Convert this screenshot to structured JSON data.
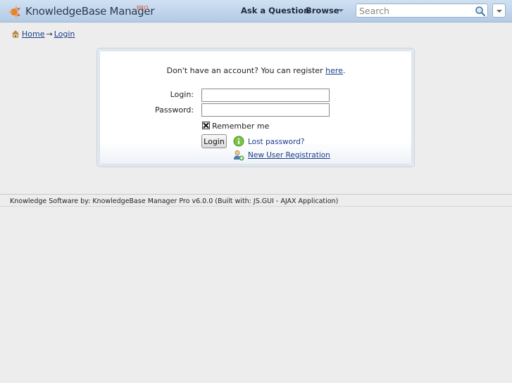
{
  "header": {
    "app_name": "KnowledgeBase Manager",
    "app_edition": "PRO",
    "nav": {
      "ask": "Ask a Question",
      "browse": "Browse"
    },
    "search": {
      "placeholder": "Search",
      "value": ""
    }
  },
  "breadcrumb": {
    "home": "Home",
    "separator": "→",
    "current": "Login"
  },
  "login": {
    "register_text": "Don't have an account? You can register ",
    "register_link": "here",
    "register_end": ".",
    "login_label": "Login:",
    "password_label": "Password:",
    "remember_label": "Remember me",
    "remember_checked": true,
    "button": "Login",
    "lost_password": "Lost password?",
    "new_user": "New User Registration"
  },
  "footer": {
    "text": "Knowledge Software by: KnowledgeBase Manager Pro v6.0.0 (Built with: JS.GUI - AJAX Application)"
  },
  "colors": {
    "header": "#c2d6ec",
    "link": "#1a3c8a",
    "background": "#ededed"
  }
}
